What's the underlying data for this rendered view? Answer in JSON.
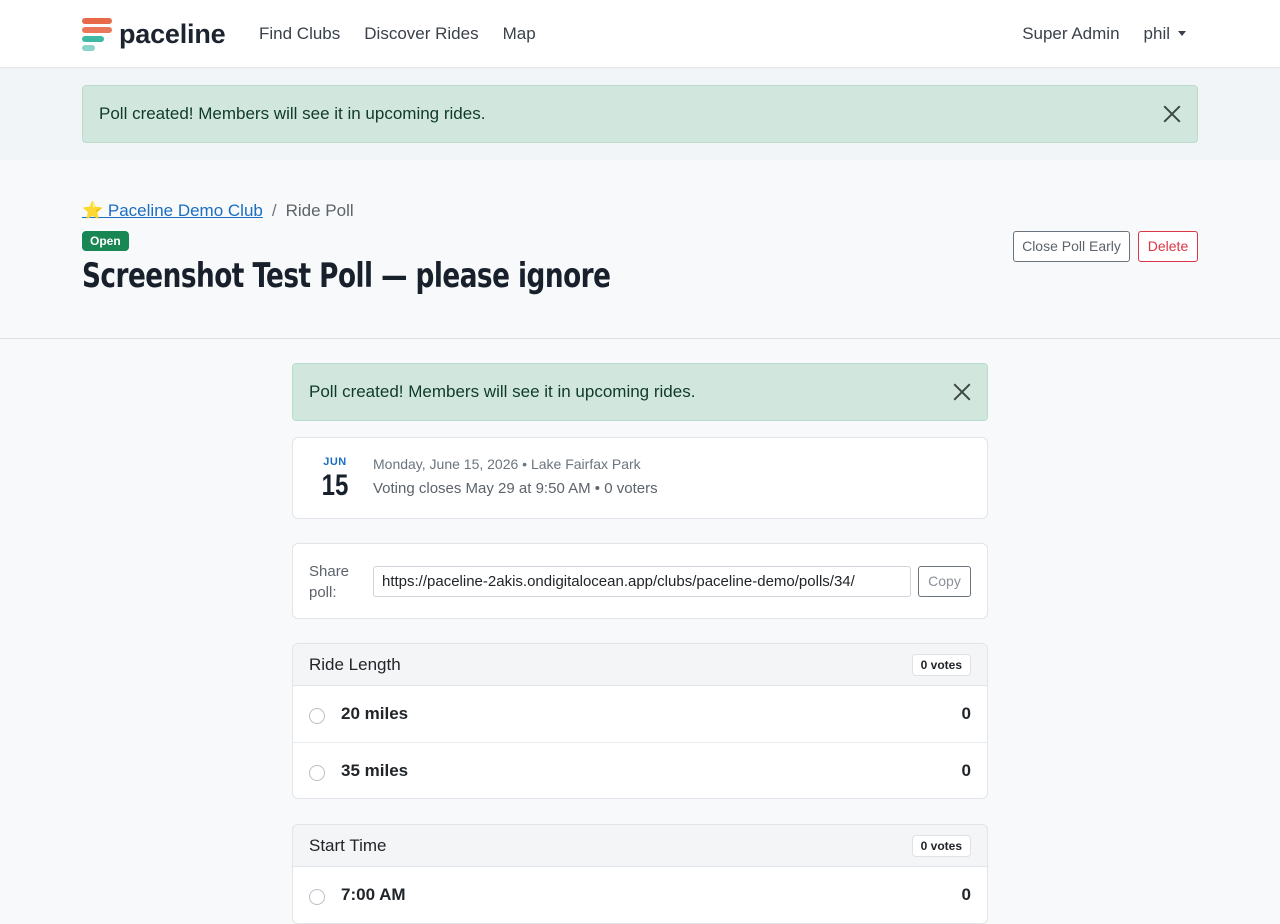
{
  "nav": {
    "brand": "paceline",
    "links": [
      "Find Clubs",
      "Discover Rides",
      "Map"
    ],
    "admin": "Super Admin",
    "user": "phil"
  },
  "alert_top": {
    "message": "Poll created! Members will see it in upcoming rides."
  },
  "header": {
    "club_link": "⭐ Paceline Demo Club",
    "separator": "/",
    "current": "Ride Poll",
    "status_badge": "Open",
    "title": "Screenshot Test Poll — please ignore",
    "close_button": "Close Poll Early",
    "delete_button": "Delete"
  },
  "alert_inner": {
    "message": "Poll created! Members will see it in upcoming rides."
  },
  "date_card": {
    "month": "JUN",
    "day": "15",
    "line1": "Monday, June 15, 2026 • Lake Fairfax Park",
    "line2": "Voting closes May 29 at 9:50 AM • 0 voters"
  },
  "share": {
    "label": "Share poll:",
    "url": "https://paceline-2akis.ondigitalocean.app/clubs/paceline-demo/polls/34/",
    "copy_button": "Copy"
  },
  "questions": [
    {
      "title": "Ride Length",
      "votes": "0 votes",
      "options": [
        {
          "label": "20 miles",
          "count": "0"
        },
        {
          "label": "35 miles",
          "count": "0"
        }
      ]
    },
    {
      "title": "Start Time",
      "votes": "0 votes",
      "options": [
        {
          "label": "7:00 AM",
          "count": "0"
        }
      ]
    }
  ],
  "colors": {
    "accent": "#1b6ec2",
    "success": "#198754",
    "danger": "#dc3545",
    "alert_bg": "#d1e7dd",
    "logo_red": "#e8684a",
    "logo_teal": "#3fb8a6"
  }
}
